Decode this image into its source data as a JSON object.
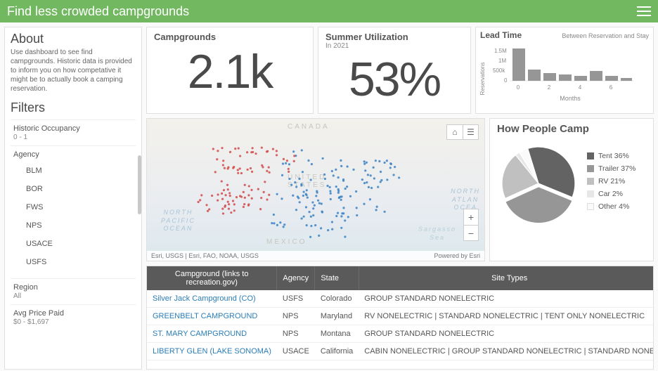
{
  "header": {
    "title": "Find less crowded campgrounds"
  },
  "about": {
    "heading": "About",
    "text": "Use dashboard to see find campgrounds. Historic data is provided to inform you on how competative it might be to actually book a camping reservation."
  },
  "filters": {
    "heading": "Filters",
    "occupancy": {
      "label": "Historic Occupancy",
      "value": "0 - 1"
    },
    "agency": {
      "label": "Agency",
      "items": [
        "BLM",
        "BOR",
        "FWS",
        "NPS",
        "USACE",
        "USFS"
      ]
    },
    "region": {
      "label": "Region",
      "value": "All"
    },
    "price": {
      "label": "Avg Price Paid",
      "value": "$0 - $1,697"
    }
  },
  "cards": {
    "campgrounds": {
      "title": "Campgrounds",
      "value": "2.1k"
    },
    "utilization": {
      "title": "Summer Utilization",
      "sub": "In 2021",
      "value": "53%"
    },
    "lead": {
      "title": "Lead Time",
      "sub": "Between Reservation and Stay",
      "ylabel": "Reservations",
      "xlabel": "Months",
      "yticks": [
        "1.5M",
        "1M",
        "500k",
        "0"
      ],
      "xticks": [
        "0",
        "2",
        "4",
        "6"
      ]
    }
  },
  "map": {
    "canada": "CANADA",
    "us": "UNITED\nSTATES",
    "mexico": "MEXICO",
    "pacific": "NORTH\nPACIFIC\nOCEAN",
    "atlantic": "NORTH\nATLAN\nOCEA",
    "sargasso": "Sargasso\nSea",
    "attrib_left": "Esri, USGS | Esri, FAO, NOAA, USGS",
    "attrib_right": "Powered by Esri"
  },
  "howcamp": {
    "title": "How People Camp",
    "items": [
      {
        "label": "Tent 36%",
        "color": "#636363"
      },
      {
        "label": "Trailer 37%",
        "color": "#969696"
      },
      {
        "label": "RV 21%",
        "color": "#c0c0c0"
      },
      {
        "label": "Car 2%",
        "color": "#e7e7e7"
      },
      {
        "label": "Other 4%",
        "color": "#fafafa"
      }
    ]
  },
  "table": {
    "headers": [
      "Campground (links to recreation.gov)",
      "Agency",
      "State",
      "Site Types"
    ],
    "rows": [
      {
        "name": "Silver Jack Campground (CO)",
        "agency": "USFS",
        "state": "Colorado",
        "types": "GROUP STANDARD NONELECTRIC"
      },
      {
        "name": "GREENBELT CAMPGROUND",
        "agency": "NPS",
        "state": "Maryland",
        "types": "RV NONELECTRIC | STANDARD NONELECTRIC | TENT ONLY NONELECTRIC"
      },
      {
        "name": "ST. MARY CAMPGROUND",
        "agency": "NPS",
        "state": "Montana",
        "types": "GROUP STANDARD NONELECTRIC"
      },
      {
        "name": "LIBERTY GLEN (LAKE SONOMA)",
        "agency": "USACE",
        "state": "California",
        "types": "CABIN NONELECTRIC | GROUP STANDARD NONELECTRIC | STANDARD NONE"
      }
    ]
  },
  "chart_data": [
    {
      "type": "bar",
      "title": "Lead Time",
      "subtitle": "Between Reservation and Stay",
      "xlabel": "Months",
      "ylabel": "Reservations",
      "ylim": [
        0,
        1500000
      ],
      "categories": [
        0,
        1,
        2,
        3,
        4,
        5,
        6,
        7
      ],
      "values": [
        1300000,
        420000,
        300000,
        250000,
        200000,
        380000,
        200000,
        120000
      ]
    },
    {
      "type": "pie",
      "title": "How People Camp",
      "series": [
        {
          "name": "Tent",
          "value": 36
        },
        {
          "name": "Trailer",
          "value": 37
        },
        {
          "name": "RV",
          "value": 21
        },
        {
          "name": "Car",
          "value": 2
        },
        {
          "name": "Other",
          "value": 4
        }
      ]
    }
  ]
}
